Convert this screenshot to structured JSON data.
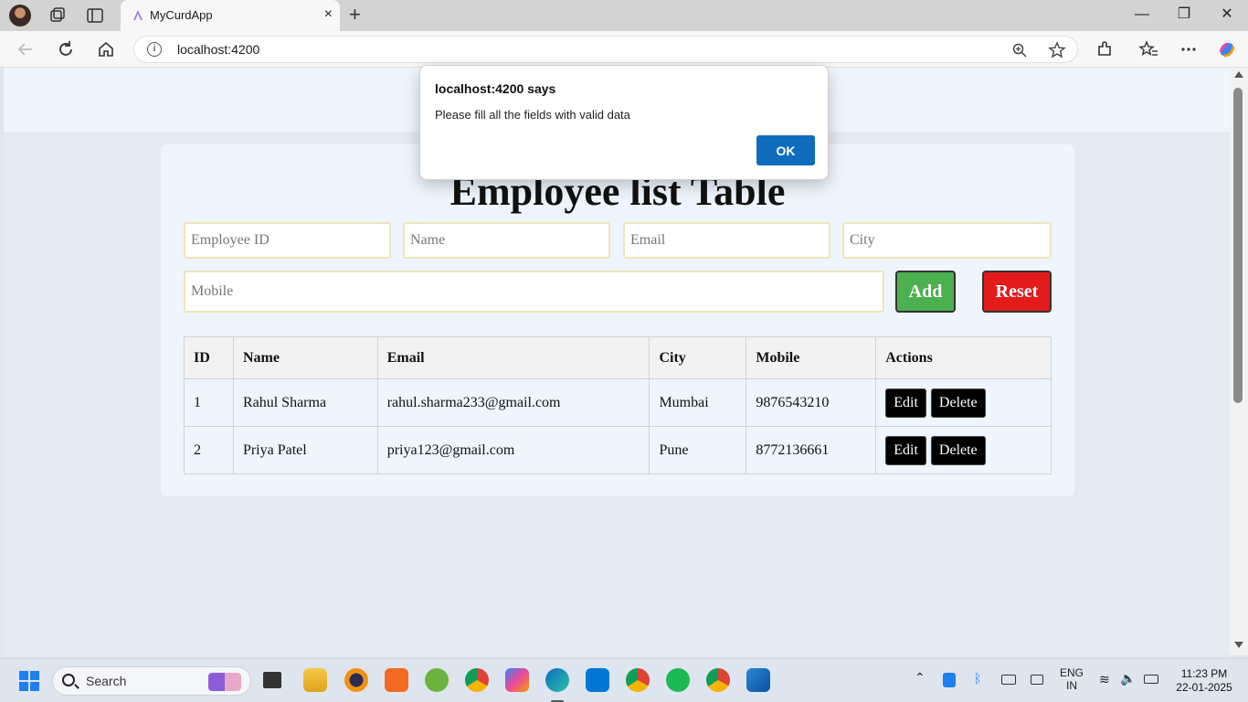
{
  "browser": {
    "tab_title": "MyCurdApp",
    "tab_close": "×",
    "new_tab": "+",
    "url": "localhost:4200",
    "window_controls": {
      "minimize": "—",
      "maximize": "❐",
      "close": "✕"
    }
  },
  "dialog": {
    "title": "localhost:4200 says",
    "message": "Please fill all the fields with valid data",
    "ok_label": "OK"
  },
  "page": {
    "title": "Employee list Table",
    "form": {
      "employee_id_placeholder": "Employee ID",
      "name_placeholder": "Name",
      "email_placeholder": "Email",
      "city_placeholder": "City",
      "mobile_placeholder": "Mobile",
      "add_label": "Add",
      "reset_label": "Reset"
    },
    "table": {
      "headers": [
        "ID",
        "Name",
        "Email",
        "City",
        "Mobile",
        "Actions"
      ],
      "rows": [
        {
          "id": "1",
          "name": "Rahul Sharma",
          "email": "rahul.sharma233@gmail.com",
          "city": "Mumbai",
          "mobile": "9876543210",
          "edit": "Edit",
          "delete": "Delete"
        },
        {
          "id": "2",
          "name": "Priya Patel",
          "email": "priya123@gmail.com",
          "city": "Pune",
          "mobile": "8772136661",
          "edit": "Edit",
          "delete": "Delete"
        }
      ]
    }
  },
  "taskbar": {
    "search_label": "Search",
    "language": "ENG",
    "region": "IN",
    "time": "11:23 PM",
    "date": "22-01-2025"
  },
  "colors": {
    "add_button": "#4caf50",
    "reset_button": "#e31b1b",
    "dialog_ok": "#0f6cbd",
    "card_background": "#eef5fd"
  }
}
